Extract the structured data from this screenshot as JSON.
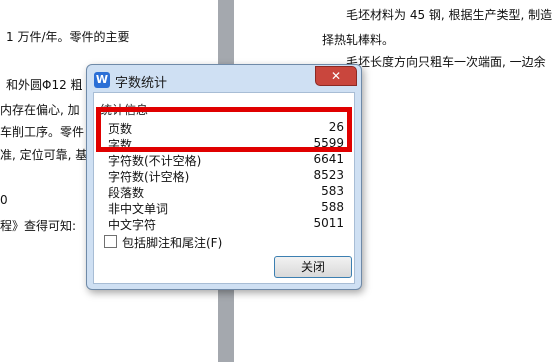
{
  "document": {
    "left_lines": [
      "1 万件/年。零件的主要",
      "和外圆Φ12 粗",
      "内存在偏心, 加",
      "车削工序。零件",
      "准, 定位可靠, 基",
      "0",
      "程》查得可知:"
    ],
    "right_lines": [
      "毛坯材料为 45 钢, 根据生产类型, 制造",
      "择热轧棒料。",
      "毛坯长度方向只粗车一次端面, 一边余"
    ]
  },
  "dialog": {
    "title": "字数统计",
    "app_icon_glyph": "W",
    "close_glyph": "✕",
    "group_title": "统计信息",
    "stats": [
      {
        "label": "页数",
        "value": "26"
      },
      {
        "label": "字数",
        "value": "5599"
      },
      {
        "label": "字符数(不计空格)",
        "value": "6641"
      },
      {
        "label": "字符数(计空格)",
        "value": "8523"
      },
      {
        "label": "段落数",
        "value": "583"
      },
      {
        "label": "非中文单词",
        "value": "588"
      },
      {
        "label": "中文字符",
        "value": "5011"
      }
    ],
    "checkbox_label": "包括脚注和尾注(F)",
    "checkbox_checked": false,
    "close_button_label": "关闭"
  },
  "colors": {
    "highlight": "#e00000",
    "title_close": "#c9463d",
    "app_icon": "#2b6fd6"
  }
}
